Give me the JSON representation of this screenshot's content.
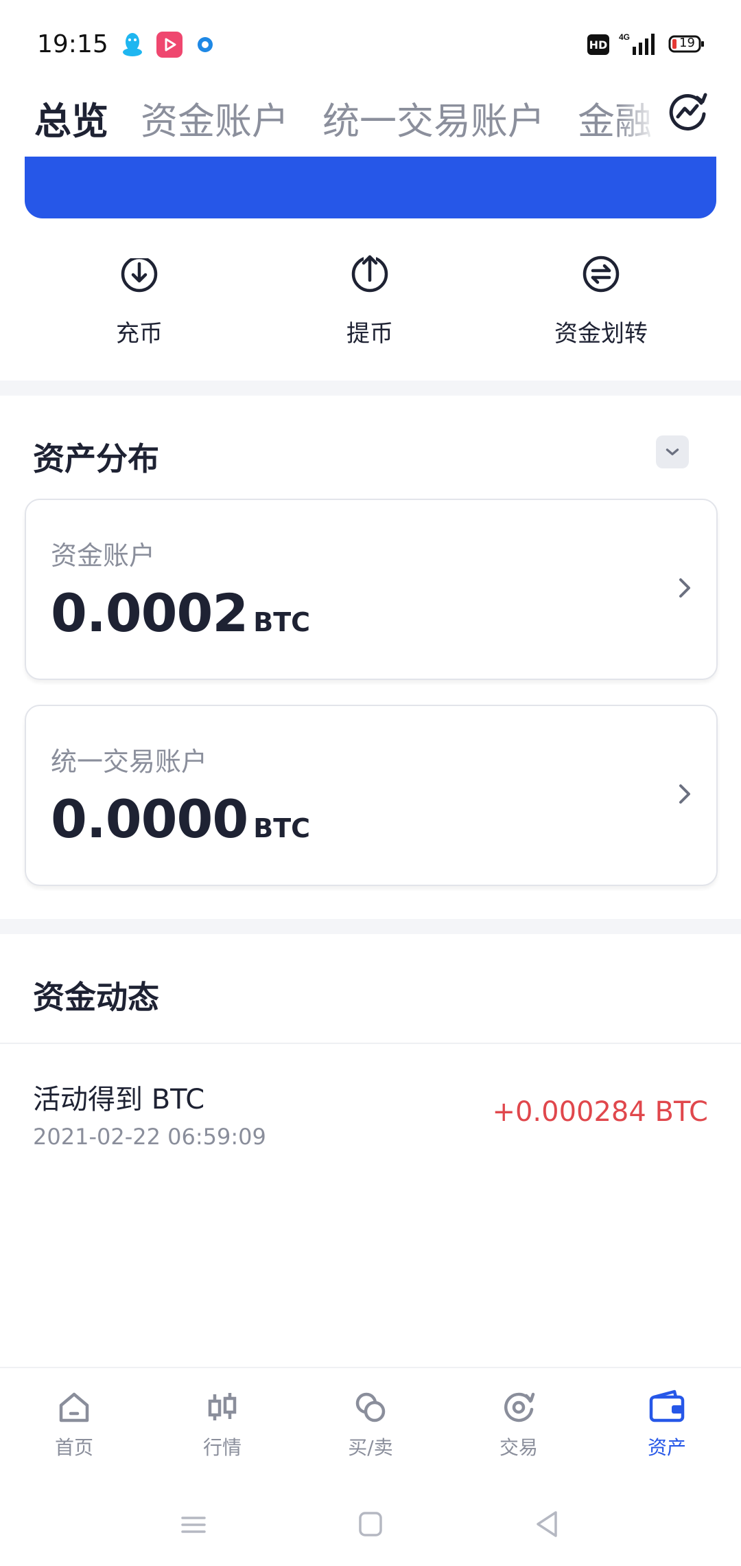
{
  "status_bar": {
    "time": "19:15",
    "hd": "HD",
    "battery": "19",
    "icons": [
      "qq-icon",
      "video-app-icon",
      "dot-app-icon",
      "signal-4g-icon",
      "battery-icon"
    ]
  },
  "tabs": {
    "items": [
      "总览",
      "资金账户",
      "统一交易账户",
      "金融"
    ],
    "active": "总览"
  },
  "quick_actions": [
    {
      "label": "充币",
      "icon": "deposit-icon"
    },
    {
      "label": "提币",
      "icon": "withdraw-icon"
    },
    {
      "label": "资金划转",
      "icon": "transfer-icon"
    }
  ],
  "asset_distribution": {
    "title": "资产分布",
    "accounts": [
      {
        "name": "资金账户",
        "amount": "0.0002",
        "unit": "BTC"
      },
      {
        "name": "统一交易账户",
        "amount": "0.0000",
        "unit": "BTC"
      }
    ]
  },
  "funding_activity": {
    "title": "资金动态",
    "records": [
      {
        "title": "活动得到 BTC",
        "time": "2021-02-22 06:59:09",
        "amount": "+0.000284 BTC"
      }
    ]
  },
  "bottom_nav": {
    "items": [
      "首页",
      "行情",
      "买/卖",
      "交易",
      "资产"
    ],
    "active": "资产"
  },
  "colors": {
    "accent": "#2657e8",
    "negative_red": "#e0474c",
    "text_primary": "#1e2233",
    "text_secondary": "#8a8e9b"
  }
}
